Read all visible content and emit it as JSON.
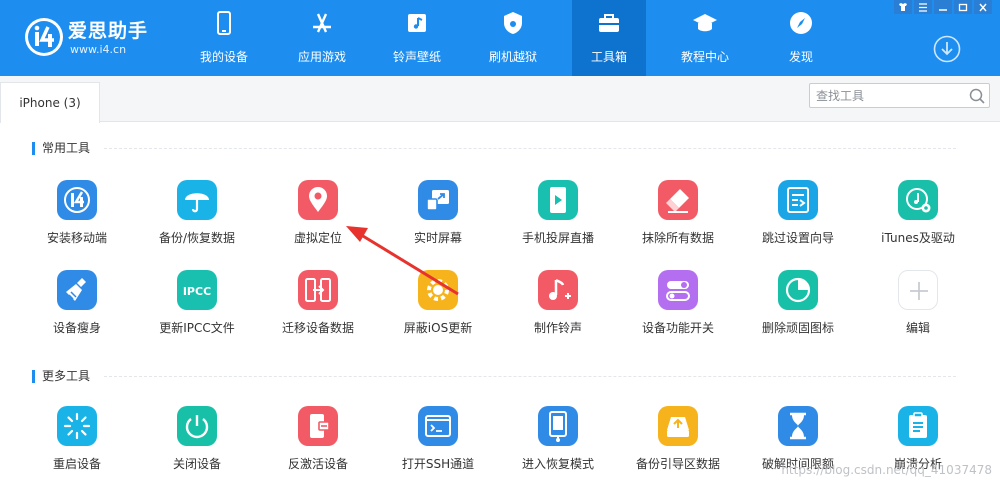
{
  "brand": {
    "name": "爱思助手",
    "url": "www.i4.cn"
  },
  "nav": [
    {
      "label": "我的设备",
      "icon": "phone-icon"
    },
    {
      "label": "应用游戏",
      "icon": "appstore-icon"
    },
    {
      "label": "铃声壁纸",
      "icon": "music-icon"
    },
    {
      "label": "刷机越狱",
      "icon": "jailbreak-icon"
    },
    {
      "label": "工具箱",
      "icon": "toolbox-icon",
      "active": true
    },
    {
      "label": "教程中心",
      "icon": "graduation-cap-icon"
    },
    {
      "label": "发现",
      "icon": "compass-icon"
    }
  ],
  "device_tab": "iPhone (3)",
  "search": {
    "placeholder": "查找工具"
  },
  "sections": {
    "common": "常用工具",
    "more": "更多工具"
  },
  "common_tools": [
    {
      "label": "安装移动端",
      "color": "#2f8be6"
    },
    {
      "label": "备份/恢复数据",
      "color": "#1ab3e8"
    },
    {
      "label": "虚拟定位",
      "color": "#f25a66"
    },
    {
      "label": "实时屏幕",
      "color": "#2f8be6"
    },
    {
      "label": "手机投屏直播",
      "color": "#19c0b0"
    },
    {
      "label": "抹除所有数据",
      "color": "#f25a66"
    },
    {
      "label": "跳过设置向导",
      "color": "#1aa6e6"
    },
    {
      "label": "iTunes及驱动",
      "color": "#19bfa8"
    },
    {
      "label": "设备瘦身",
      "color": "#2f8be6"
    },
    {
      "label": "更新IPCC文件",
      "color": "#19c0b0"
    },
    {
      "label": "迁移设备数据",
      "color": "#f25a66"
    },
    {
      "label": "屏蔽iOS更新",
      "color": "#f7b31b"
    },
    {
      "label": "制作铃声",
      "color": "#f25a66"
    },
    {
      "label": "设备功能开关",
      "color": "#b46ef0"
    },
    {
      "label": "删除顽固图标",
      "color": "#19c0a8"
    },
    {
      "label": "编辑",
      "color": "#ffffff"
    }
  ],
  "more_tools": [
    {
      "label": "重启设备",
      "color": "#1ab3e8"
    },
    {
      "label": "关闭设备",
      "color": "#19c0a8"
    },
    {
      "label": "反激活设备",
      "color": "#f25a66"
    },
    {
      "label": "打开SSH通道",
      "color": "#2f8be6"
    },
    {
      "label": "进入恢复模式",
      "color": "#2f8be6"
    },
    {
      "label": "备份引导区数据",
      "color": "#f7b31b"
    },
    {
      "label": "破解时间限额",
      "color": "#2f8be6"
    },
    {
      "label": "崩溃分析",
      "color": "#1ab3e8"
    }
  ],
  "watermark": "https://blog.csdn.net/qq_41037478"
}
